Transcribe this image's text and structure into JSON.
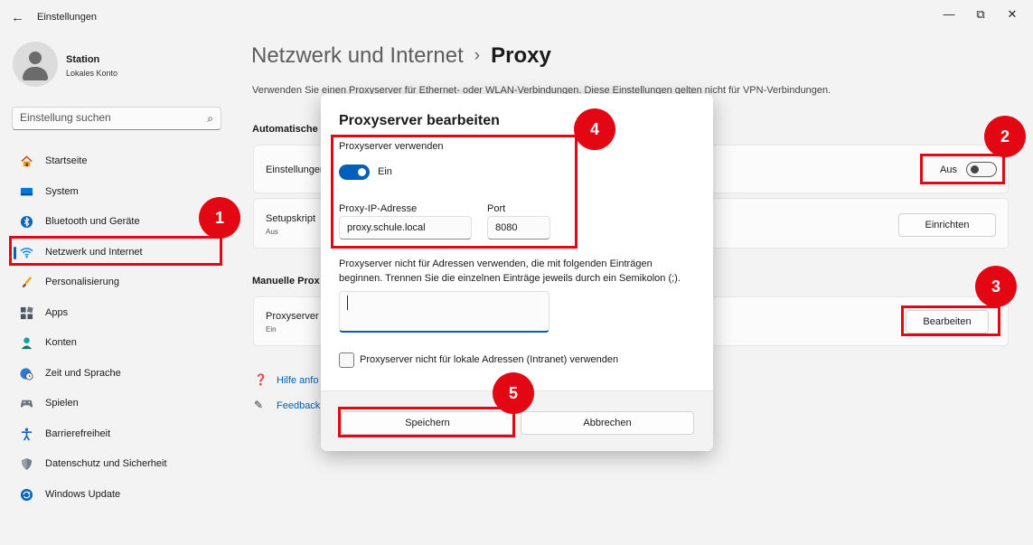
{
  "window": {
    "title": "Einstellungen",
    "back_icon": "back-arrow-icon",
    "minimize": "—",
    "maximize": "⧉",
    "close": "✕"
  },
  "user": {
    "name": "Station",
    "account": "Lokales Konto"
  },
  "search": {
    "placeholder": "Einstellung suchen",
    "icon": "search-icon"
  },
  "nav": {
    "items": [
      {
        "label": "Startseite",
        "icon": "home-icon"
      },
      {
        "label": "System",
        "icon": "system-icon"
      },
      {
        "label": "Bluetooth und Geräte",
        "icon": "bluetooth-icon"
      },
      {
        "label": "Netzwerk und Internet",
        "icon": "wifi-icon",
        "active": true
      },
      {
        "label": "Personalisierung",
        "icon": "brush-icon"
      },
      {
        "label": "Apps",
        "icon": "apps-icon"
      },
      {
        "label": "Konten",
        "icon": "account-icon"
      },
      {
        "label": "Zeit und Sprache",
        "icon": "globe-clock-icon"
      },
      {
        "label": "Spielen",
        "icon": "gamepad-icon"
      },
      {
        "label": "Barrierefreiheit",
        "icon": "accessibility-icon"
      },
      {
        "label": "Datenschutz und Sicherheit",
        "icon": "shield-icon"
      },
      {
        "label": "Windows Update",
        "icon": "update-icon"
      }
    ]
  },
  "page": {
    "breadcrumb_parent": "Netzwerk und Internet",
    "breadcrumb_sep": "›",
    "title": "Proxy",
    "description": "Verwenden Sie einen Proxyserver für Ethernet- oder WLAN-Verbindungen. Diese Einstellungen gelten nicht für VPN-Verbindungen."
  },
  "auto_section": {
    "heading": "Automatische",
    "setting_title": "Einstellungen",
    "toggle_label": "Aus",
    "script_title": "Setupskript",
    "script_sub": "Aus",
    "setup_button": "Einrichten"
  },
  "manual_section": {
    "heading": "Manuelle Prox",
    "proxy_title": "Proxyserver",
    "proxy_sub": "Ein",
    "edit_button": "Bearbeiten"
  },
  "links": {
    "help": "Hilfe anfo",
    "feedback": "Feedback"
  },
  "dialog": {
    "title": "Proxyserver bearbeiten",
    "use_proxy_label": "Proxyserver verwenden",
    "toggle_state": "Ein",
    "ip_label": "Proxy-IP-Adresse",
    "ip_value": "proxy.schule.local",
    "port_label": "Port",
    "port_value": "8080",
    "exceptions_line1": "Proxyserver nicht für Adressen verwenden, die mit folgenden Einträgen",
    "exceptions_line2": "beginnen. Trennen Sie die einzelnen Einträge jeweils durch ein Semikolon (;).",
    "exceptions_value": "",
    "local_checkbox_label": "Proxyserver nicht für lokale Adressen (Intranet) verwenden",
    "local_checkbox_checked": false,
    "save_button": "Speichern",
    "cancel_button": "Abbrechen"
  },
  "annotations": {
    "markers": [
      "1",
      "2",
      "3",
      "4",
      "5"
    ],
    "color": "#e30613"
  },
  "colors": {
    "accent": "#005fb8",
    "background": "#f3f3f3"
  }
}
